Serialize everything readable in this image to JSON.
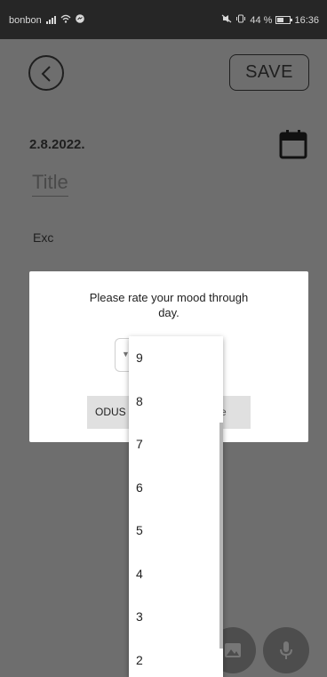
{
  "status_bar": {
    "carrier": "bonbon",
    "battery": "44 %",
    "time": "16:36",
    "battery_level_percent": 44
  },
  "editor": {
    "save_label": "SAVE",
    "date": "2.8.2022.",
    "title_placeholder": "Title",
    "text_value": "Exc"
  },
  "dialog": {
    "message": "Please rate your mood through day.",
    "cancel_label": "ODUS",
    "confirm_label": "e"
  },
  "dropdown": {
    "options": [
      "9",
      "8",
      "7",
      "6",
      "5",
      "4",
      "3",
      "2"
    ]
  },
  "icons": {
    "back": "chevron-left-icon",
    "calendar": "calendar-icon",
    "image": "image-icon",
    "mic": "mic-icon",
    "wifi": "wifi-icon",
    "signal": "signal-icon",
    "battery": "battery-icon"
  },
  "colors": {
    "overlay_background": "#6e6e6e",
    "status_bar": "#262626",
    "dialog_background": "#ffffff",
    "dialog_button": "#e0e0e0"
  }
}
